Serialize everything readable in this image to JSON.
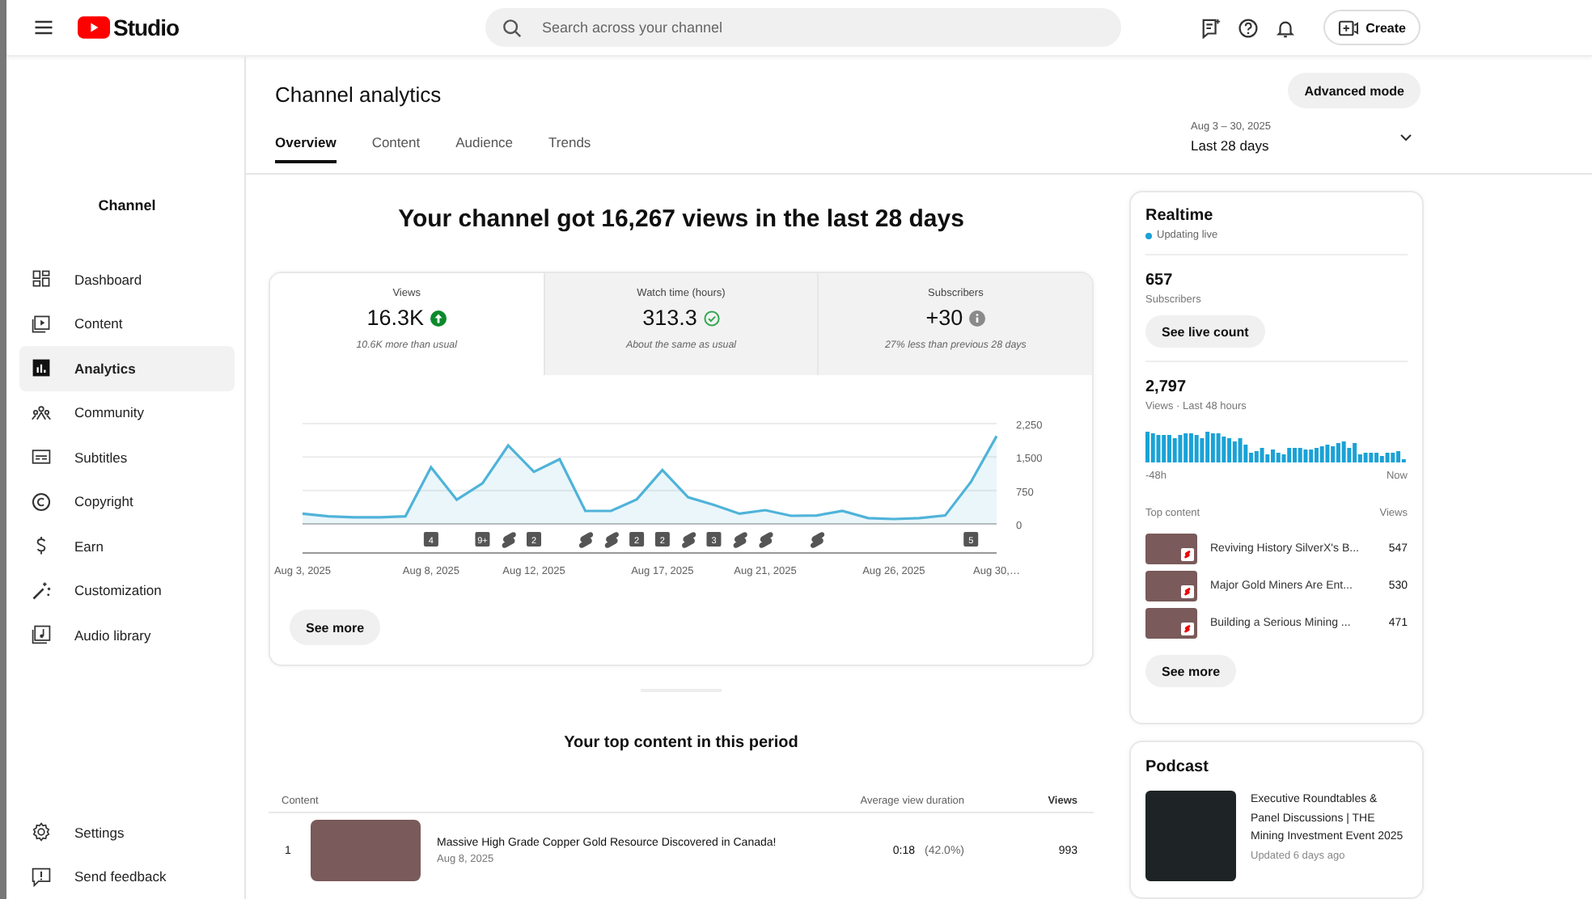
{
  "topbar": {
    "logo_text": "Studio",
    "search": {
      "placeholder": "Search across your channel"
    },
    "create_button": "Create"
  },
  "sidebar": {
    "heading": "Channel",
    "items": [
      {
        "label": "Dashboard",
        "selected": false
      },
      {
        "label": "Content",
        "selected": false
      },
      {
        "label": "Analytics",
        "selected": true
      },
      {
        "label": "Community",
        "selected": false
      },
      {
        "label": "Subtitles",
        "selected": false
      },
      {
        "label": "Copyright",
        "selected": false
      },
      {
        "label": "Earn",
        "selected": false
      },
      {
        "label": "Customization",
        "selected": false
      },
      {
        "label": "Audio library",
        "selected": false
      }
    ],
    "footer_items": [
      {
        "label": "Settings"
      },
      {
        "label": "Send feedback"
      }
    ]
  },
  "page": {
    "title": "Channel analytics",
    "advanced_button": "Advanced mode",
    "tabs": [
      {
        "label": "Overview",
        "selected": true
      },
      {
        "label": "Content",
        "selected": false
      },
      {
        "label": "Audience",
        "selected": false
      },
      {
        "label": "Trends",
        "selected": false
      }
    ],
    "date_range": {
      "dates": "Aug 3 – 30, 2025",
      "period": "Last 28 days"
    }
  },
  "overview": {
    "headline": "Your channel got 16,267 views in the last 28 days",
    "metrics": [
      {
        "label": "Views",
        "value": "16.3K",
        "kind": "up",
        "note": "10.6K more than usual",
        "selected": true
      },
      {
        "label": "Watch time (hours)",
        "value": "313.3",
        "kind": "normal",
        "note": "About the same as usual",
        "selected": false
      },
      {
        "label": "Subscribers",
        "value": "+30",
        "kind": "neutral",
        "note": "27% less than previous 28 days",
        "selected": false
      }
    ],
    "chart_data": {
      "type": "area",
      "categories": [
        "Aug 3, 2025",
        null,
        null,
        null,
        null,
        "Aug 8, 2025",
        null,
        null,
        null,
        "Aug 12, 2025",
        null,
        null,
        null,
        null,
        "Aug 17, 2025",
        null,
        null,
        null,
        "Aug 21, 2025",
        null,
        null,
        null,
        null,
        "Aug 26, 2025",
        null,
        null,
        null,
        "Aug 30,…"
      ],
      "series": [
        {
          "color": "#4fb3d9",
          "values": [
            230,
            170,
            150,
            150,
            170,
            1270,
            540,
            910,
            1760,
            1170,
            1450,
            290,
            290,
            550,
            1210,
            600,
            430,
            230,
            310,
            180,
            190,
            290,
            130,
            110,
            130,
            190,
            940,
            1970
          ]
        }
      ],
      "ylim": [
        0,
        2250
      ],
      "yticks": [
        {
          "value": 0,
          "label": "0"
        },
        {
          "value": 750,
          "label": "750"
        },
        {
          "value": 1500,
          "label": "1,500"
        },
        {
          "value": 2250,
          "label": "2,250"
        }
      ]
    },
    "markers": [
      {
        "kind": "none"
      },
      {
        "kind": "none"
      },
      {
        "kind": "none"
      },
      {
        "kind": "none"
      },
      {
        "kind": "none"
      },
      {
        "kind": "count",
        "label": "4"
      },
      {
        "kind": "none"
      },
      {
        "kind": "count",
        "label": "9+"
      },
      {
        "kind": "short"
      },
      {
        "kind": "count",
        "label": "2"
      },
      {
        "kind": "none"
      },
      {
        "kind": "short"
      },
      {
        "kind": "short"
      },
      {
        "kind": "count",
        "label": "2"
      },
      {
        "kind": "count",
        "label": "2"
      },
      {
        "kind": "short"
      },
      {
        "kind": "count",
        "label": "3"
      },
      {
        "kind": "short"
      },
      {
        "kind": "short"
      },
      {
        "kind": "none"
      },
      {
        "kind": "short"
      },
      {
        "kind": "none"
      },
      {
        "kind": "none"
      },
      {
        "kind": "none"
      },
      {
        "kind": "none"
      },
      {
        "kind": "none"
      },
      {
        "kind": "count",
        "label": "5"
      },
      {
        "kind": "none"
      }
    ],
    "see_more": "See more"
  },
  "top_content": {
    "title": "Your top content in this period",
    "columns": [
      "Content",
      "Average view duration",
      "Views"
    ],
    "rows": [
      {
        "rank": "1",
        "title": "Massive High Grade Copper Gold Resource Discovered in Canada!",
        "date": "Aug 8, 2025",
        "duration": "0:18",
        "percent": "(42.0%)",
        "views": "993"
      }
    ]
  },
  "realtime": {
    "title": "Realtime",
    "status": "Updating live",
    "subscribers": {
      "value": "657",
      "label": "Subscribers",
      "button": "See live count"
    },
    "views": {
      "value": "2,797",
      "label": "Views · Last 48 hours",
      "axis_start": "-48h",
      "axis_end": "Now"
    },
    "top_content": {
      "heading": "Top content",
      "views_heading": "Views",
      "items": [
        {
          "title": "Reviving History SilverX's B...",
          "views": "547"
        },
        {
          "title": "Major Gold Miners Are Ent...",
          "views": "530"
        },
        {
          "title": "Building a Serious Mining ...",
          "views": "471"
        }
      ]
    },
    "see_more": "See more"
  },
  "podcast": {
    "title": "Podcast",
    "name": "Executive Roundtables & Panel Discussions | THE Mining Investment Event 2025",
    "updated": "Updated 6 days ago"
  }
}
